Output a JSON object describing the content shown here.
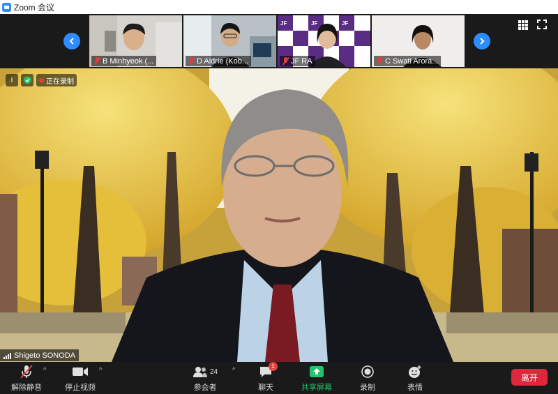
{
  "window": {
    "title": "Zoom 会议"
  },
  "thumbnails": [
    {
      "name": "B Minhyeok (..."
    },
    {
      "name": "D Aldrie (Kob..."
    },
    {
      "name": "JF RA"
    },
    {
      "name": "C Swati Arora..."
    }
  ],
  "main_view": {
    "speaker_name": "Shigeto SONODA",
    "overlay_status": "正在录制"
  },
  "toolbar": {
    "unmute": "解除静音",
    "stop_video": "停止视频",
    "participants": "参会者",
    "participant_count": "24",
    "chat": "聊天",
    "chat_badge": "1",
    "share_screen": "共享屏幕",
    "record": "录制",
    "reactions": "表情",
    "leave": "离开"
  },
  "colors": {
    "accent": "#2d8cff",
    "share_green": "#23c36b",
    "leave_red": "#e0263a",
    "muted_red": "#e03e3e"
  }
}
